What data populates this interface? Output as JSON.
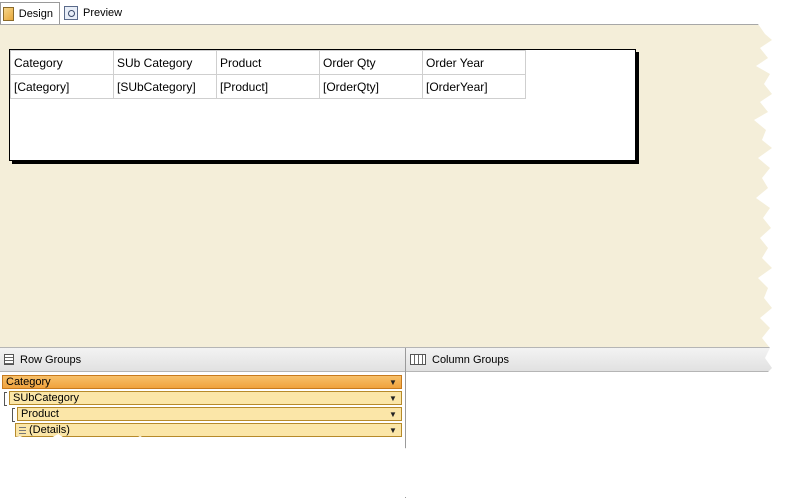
{
  "tabs": [
    {
      "label": "Design",
      "icon": "design-icon",
      "active": true
    },
    {
      "label": "Preview",
      "icon": "preview-icon",
      "active": false
    }
  ],
  "report": {
    "headers": [
      "Category",
      "SUb Category",
      "Product",
      "Order Qty",
      "Order Year"
    ],
    "row": [
      "[Category]",
      "[SUbCategory]",
      "[Product]",
      "[OrderQty]",
      "[OrderYear]"
    ]
  },
  "row_groups": {
    "title": "Row Groups",
    "items": [
      {
        "label": "Category",
        "selected": true
      },
      {
        "label": "SUbCategory",
        "selected": false
      },
      {
        "label": "Product",
        "selected": false
      },
      {
        "label": "(Details)",
        "selected": false
      }
    ]
  },
  "column_groups": {
    "title": "Column Groups"
  },
  "colors": {
    "canvas": "#f4eed9",
    "group_selected": "#f0a23c",
    "group": "#fbe6a8"
  }
}
